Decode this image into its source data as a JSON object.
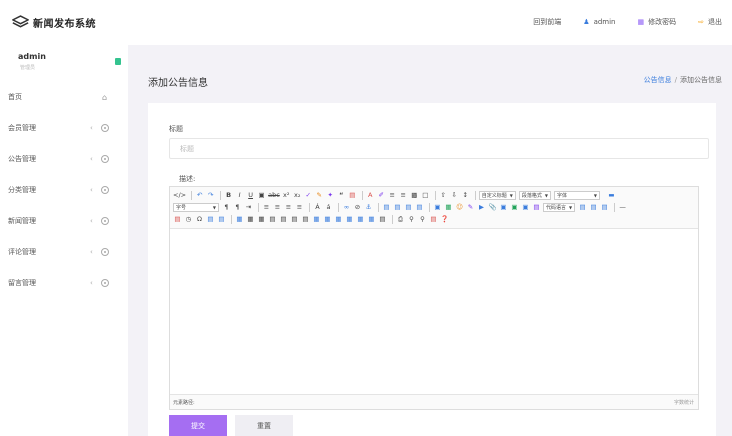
{
  "header": {
    "app_title": "新闻发布系统",
    "logo_icon": "layers-icon",
    "nav": {
      "home_label": "回到前端",
      "user_label": "admin",
      "password_label": "修改密码",
      "logout_label": "退出"
    }
  },
  "sidebar": {
    "user_name": "admin",
    "user_role": "管理员",
    "items": [
      {
        "label": "首页",
        "icon": "home-icon"
      },
      {
        "label": "会员管理"
      },
      {
        "label": "公告管理"
      },
      {
        "label": "分类管理"
      },
      {
        "label": "新闻管理"
      },
      {
        "label": "评论管理"
      },
      {
        "label": "留言管理"
      }
    ]
  },
  "main": {
    "page_title": "添加公告信息",
    "breadcrumb": {
      "link": "公告信息",
      "separator": "/",
      "current": "添加公告信息"
    }
  },
  "form": {
    "title_label": "标题",
    "title_placeholder": "标题",
    "desc_label": "描述:",
    "editor": {
      "dropdowns": [
        "自定义标题",
        "段落格式",
        "字体",
        "字号",
        "代码语言"
      ],
      "path_label": "元素路径:",
      "word_count_label": "字数统计"
    },
    "submit_label": "提交",
    "reset_label": "重置"
  },
  "colors": {
    "accent": "#a56ef2",
    "link": "#3b7ddd",
    "main_bg": "#f3f2f7",
    "badge": "#34c38f"
  }
}
